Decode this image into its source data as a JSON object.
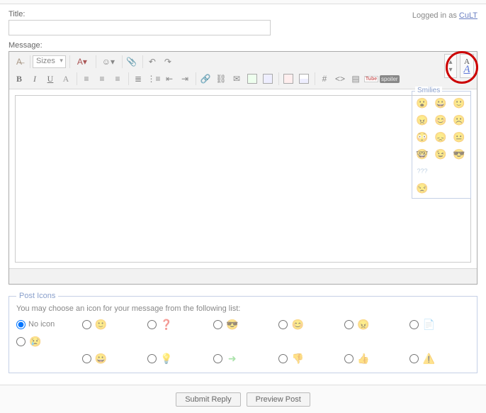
{
  "labels": {
    "title": "Title:",
    "message": "Message:",
    "logged_prefix": "Logged in as ",
    "username": "CuLT",
    "sizes": "Sizes",
    "smilies": "Smilies",
    "post_icons_legend": "Post Icons",
    "post_icons_desc": "You may choose an icon for your message from the following list:",
    "no_icon": "No icon",
    "submit": "Submit Reply",
    "preview": "Preview Post",
    "spoiler": "spoiler",
    "youtube": "Tube"
  },
  "form": {
    "title_value": "",
    "message_value": ""
  },
  "chart_data": null
}
